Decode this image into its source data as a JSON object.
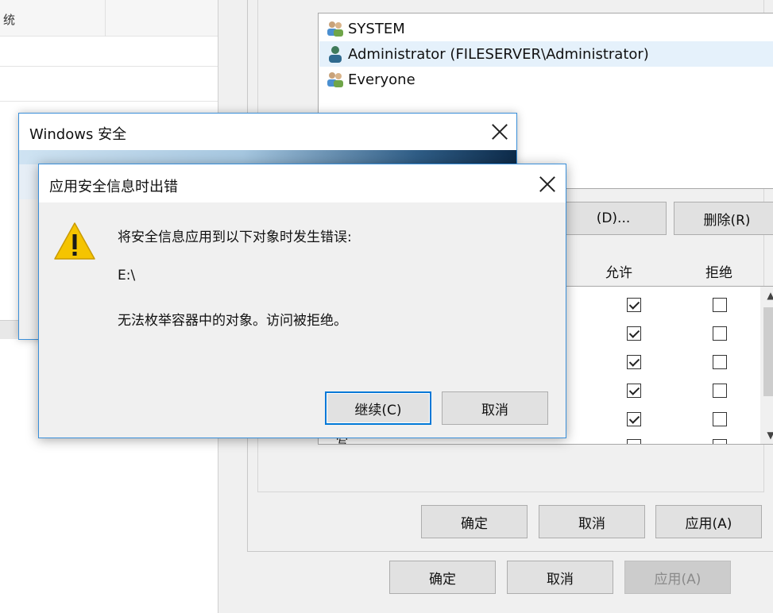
{
  "back_window": {
    "header_text": "统"
  },
  "properties": {
    "users": [
      {
        "name": "SYSTEM",
        "icon": "users-group-icon"
      },
      {
        "name": "Administrator (FILESERVER\\Administrator)",
        "icon": "user-icon"
      },
      {
        "name": "Everyone",
        "icon": "users-group-icon"
      }
    ],
    "add_button": "(D)...",
    "remove_button": "删除(R)",
    "allow_header": "允许",
    "deny_header": "拒绝",
    "permissions": [
      {
        "allow": true,
        "deny": false
      },
      {
        "allow": true,
        "deny": false
      },
      {
        "allow": true,
        "deny": false
      },
      {
        "allow": true,
        "deny": false
      },
      {
        "allow": true,
        "deny": false
      }
    ],
    "partial_row_label": "写",
    "inner_buttons": {
      "ok": "确定",
      "cancel": "取消",
      "apply": "应用(A)"
    },
    "outer_buttons": {
      "ok": "确定",
      "cancel": "取消",
      "apply": "应用(A)"
    }
  },
  "windows_security": {
    "title": "Windows 安全"
  },
  "error_dialog": {
    "title": "应用安全信息时出错",
    "message_line1": "将安全信息应用到以下对象时发生错误:",
    "object_path": "E:\\",
    "message_line2": "无法枚举容器中的对象。访问被拒绝。",
    "continue_button": "继续(C)",
    "cancel_button": "取消"
  },
  "colors": {
    "accent": "#0078d7",
    "warning_yellow": "#f5c400",
    "selection": "#e5f1fb"
  }
}
